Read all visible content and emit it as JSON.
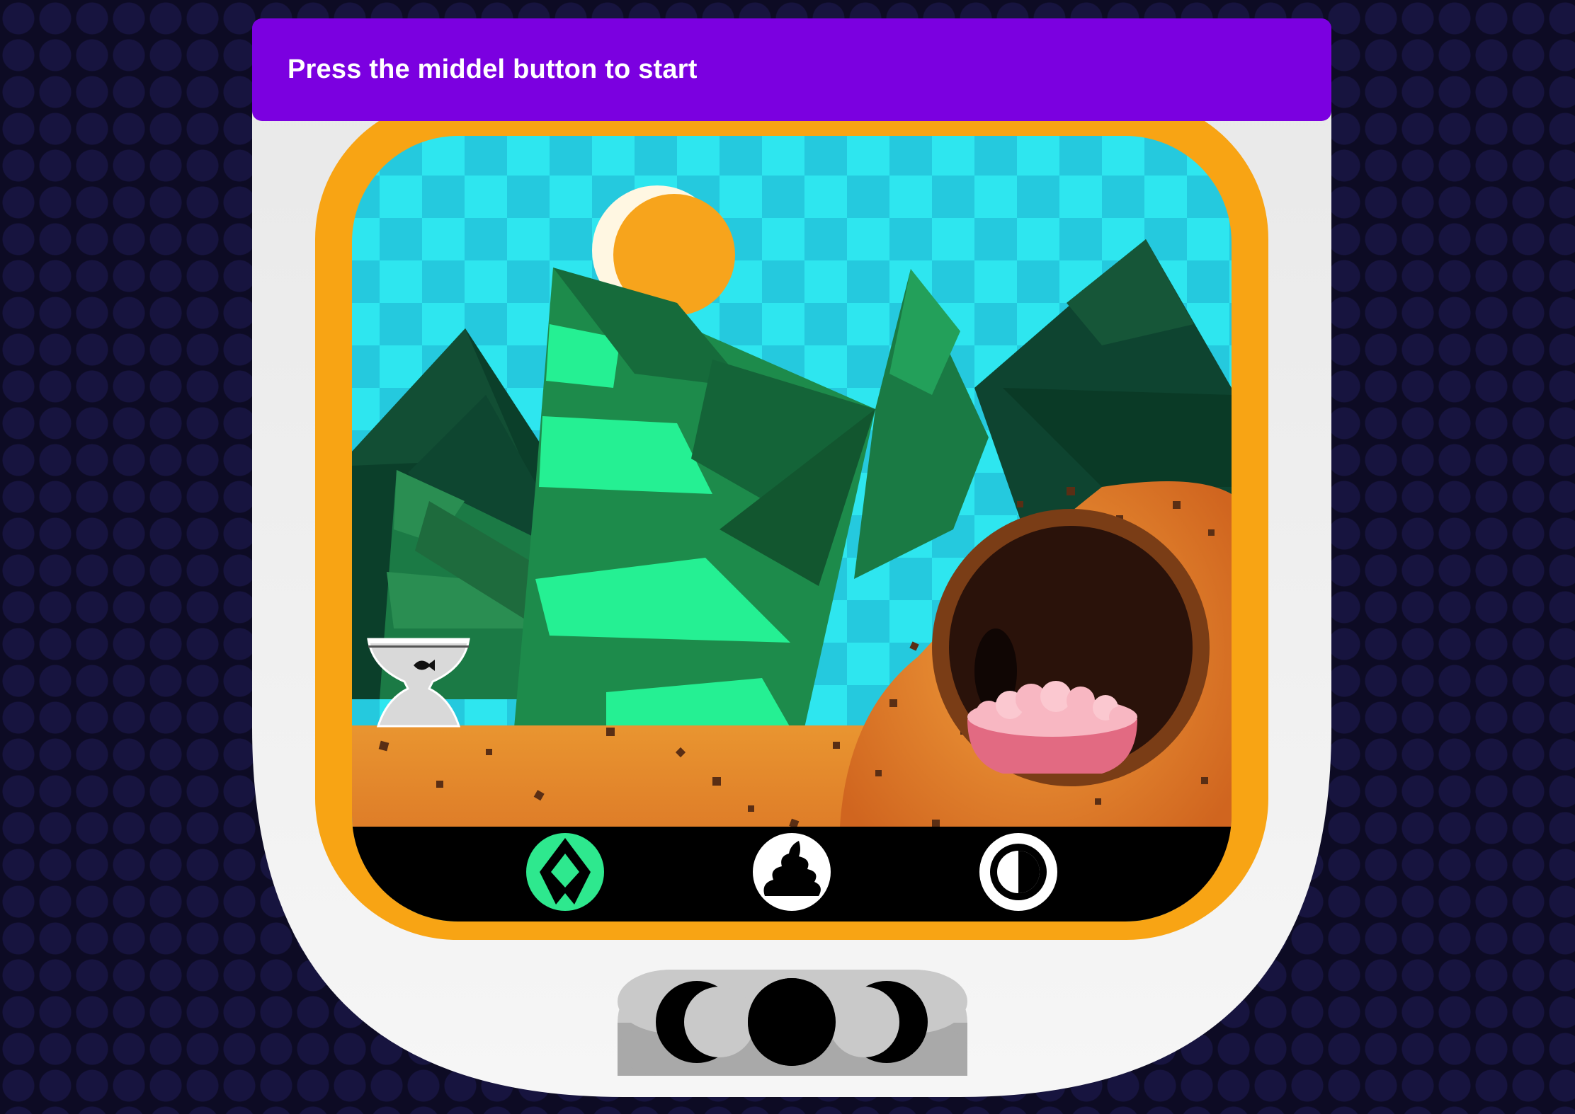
{
  "banner": {
    "message": "Press the middel button to start"
  },
  "screen": {
    "status_icons": [
      {
        "name": "food-icon",
        "active": true
      },
      {
        "name": "poop-icon",
        "active": false
      },
      {
        "name": "day-night-icon",
        "active": false
      }
    ],
    "sky_color": "#2ee6ef",
    "frame_color": "#f8a414",
    "ground_color": "#e0832a"
  },
  "controls": {
    "buttons": [
      {
        "name": "left-button"
      },
      {
        "name": "middle-button"
      },
      {
        "name": "right-button"
      }
    ]
  },
  "colors": {
    "banner_bg": "#7b00e0",
    "background": "#0d0b24",
    "active_icon": "#2ee88e"
  }
}
